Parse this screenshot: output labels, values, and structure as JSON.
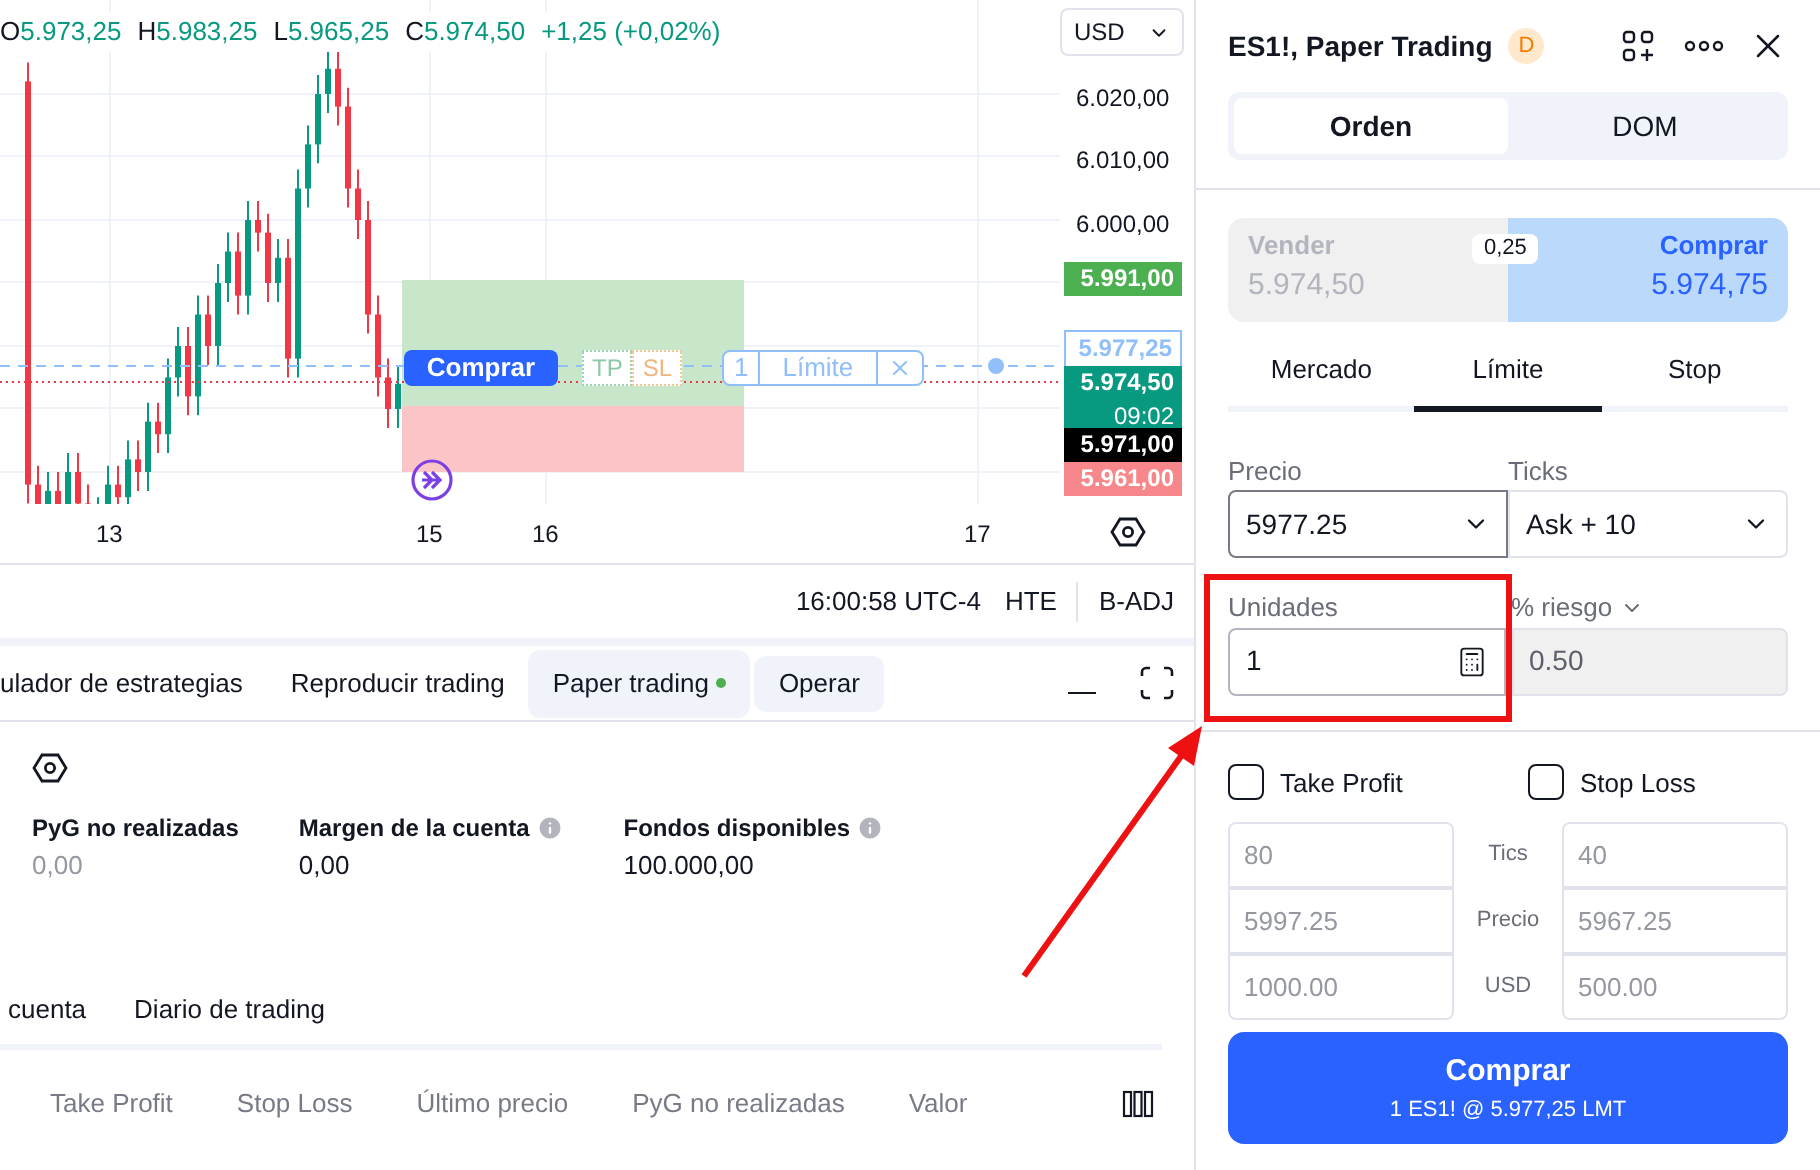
{
  "chart": {
    "legend": [
      {
        "label": "O",
        "value": "5.973,25"
      },
      {
        "label": "H",
        "value": "5.983,25"
      },
      {
        "label": "L",
        "value": "5.965,25"
      },
      {
        "label": "C",
        "value": "5.974,50"
      }
    ],
    "change": "+1,25 (+0,02%)",
    "currency": "USD",
    "price_scale": [
      "6.020,00",
      "6.010,00",
      "6.000,00"
    ],
    "price_badges": [
      {
        "kind": "solid",
        "text": "5.991,00",
        "color": "#4caf50"
      },
      {
        "kind": "outline",
        "text": "5.977,25",
        "color": "#90bff9"
      },
      {
        "kind": "solid",
        "text": "5.974,50",
        "sub": "09:02",
        "color": "#089981"
      },
      {
        "kind": "solid",
        "text": "5.971,00",
        "color": "#000000"
      },
      {
        "kind": "solid",
        "text": "5.961,00",
        "color": "#f7878a"
      }
    ],
    "time_scale": [
      "13",
      "15",
      "16",
      "17"
    ],
    "order_line": {
      "side": "Comprar",
      "tp": "TP",
      "sl": "SL",
      "quantity": "1",
      "type": "Límite"
    }
  },
  "status_row": {
    "time": "16:00:58 UTC-4",
    "session": "HTE",
    "adjustment": "B-ADJ"
  },
  "bottom_tabs": [
    {
      "label": "ulador de estrategias",
      "selected": false,
      "live": false
    },
    {
      "label": "Reproducir trading",
      "selected": false,
      "live": false
    },
    {
      "label": "Paper trading",
      "selected": true,
      "live": true
    }
  ],
  "operate_button": "Operar",
  "account": {
    "metrics": [
      {
        "label": "PyG no realizadas",
        "value": "0,00",
        "info": false,
        "muted": true
      },
      {
        "label": "Margen de la cuenta",
        "value": "0,00",
        "info": true,
        "muted": false
      },
      {
        "label": "Fondos disponibles",
        "value": "100.000,00",
        "info": true,
        "muted": false
      }
    ]
  },
  "sub_tabs": [
    "cuenta",
    "Diario de trading"
  ],
  "columns": [
    "Take Profit",
    "Stop Loss",
    "Último precio",
    "PyG no realizadas",
    "Valor"
  ],
  "panel": {
    "title": "ES1!, Paper Trading",
    "badge": "D",
    "views": [
      {
        "label": "Orden",
        "selected": true
      },
      {
        "label": "DOM",
        "selected": false
      }
    ],
    "quote": {
      "sell": {
        "label": "Vender",
        "price": "5.974,50",
        "selected": false
      },
      "spread": "0,25",
      "buy": {
        "label": "Comprar",
        "price": "5.974,75",
        "selected": true
      }
    },
    "order_types": [
      {
        "label": "Mercado",
        "selected": false
      },
      {
        "label": "Límite",
        "selected": true
      },
      {
        "label": "Stop",
        "selected": false
      }
    ],
    "price": {
      "label": "Precio",
      "value": "5977.25"
    },
    "ticks": {
      "label": "Ticks",
      "value": "Ask + 10"
    },
    "units": {
      "label": "Unidades",
      "value": "1"
    },
    "risk": {
      "label": "% riesgo",
      "value": "0.50",
      "disabled": true
    },
    "brackets": [
      {
        "label": "Take Profit",
        "checked": false,
        "values": [
          "80",
          "5997.25",
          "1000.00"
        ]
      },
      {
        "label": "Stop Loss",
        "checked": false,
        "values": [
          "40",
          "5967.25",
          "500.00"
        ]
      }
    ],
    "bracket_rows": [
      "Tics",
      "Precio",
      "USD"
    ],
    "submit": {
      "label": "Comprar",
      "detail": "1 ES1! @ 5.977,25 LMT"
    }
  }
}
